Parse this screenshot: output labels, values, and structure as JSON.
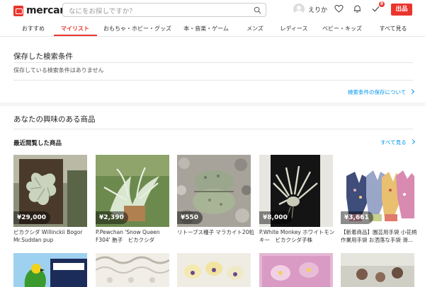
{
  "header": {
    "logo_text": "mercari",
    "search_placeholder": "なにをお探しですか？",
    "username": "えりか",
    "notification_count": "8",
    "sell_label": "出品"
  },
  "tabs": [
    {
      "label": "おすすめ"
    },
    {
      "label": "マイリスト"
    },
    {
      "label": "おもちゃ・ホビー・グッズ"
    },
    {
      "label": "本・音楽・ゲーム"
    },
    {
      "label": "メンズ"
    },
    {
      "label": "レディース"
    },
    {
      "label": "ベビー・キッズ"
    },
    {
      "label": "すべて見る"
    }
  ],
  "saved": {
    "title": "保存した検索条件",
    "empty": "保存している検索条件はありません",
    "about_link": "検索条件の保存について"
  },
  "interest": {
    "title": "あなたの興味のある商品",
    "recent_title": "最近閲覧した商品",
    "see_all": "すべて見る"
  },
  "products": [
    {
      "price": "¥29,000",
      "name": "ビカクシダ Willinckii Bogor Mr.Suddan pup"
    },
    {
      "price": "¥2,390",
      "name": "P.Pewchan 'Snow Queen F304' 胞子　ビカクシダ"
    },
    {
      "price": "¥550",
      "name": "リトープス種子 マラカイト20粒"
    },
    {
      "price": "¥8,000",
      "name": "P.White Monkey ホワイトモンキー　ビカクシダ子株"
    },
    {
      "price": "¥3,661",
      "name": "【新着商品】園芸用手袋 小花柄 作業用手袋 お洒落な手袋 滑..."
    }
  ],
  "colors": {
    "accent": "#ea352d",
    "link": "#0095ee"
  }
}
